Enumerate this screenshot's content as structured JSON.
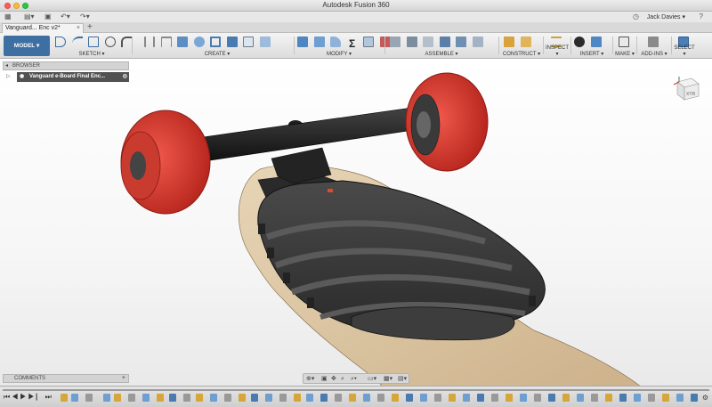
{
  "window": {
    "title": "Autodesk Fusion 360"
  },
  "quick_access": {
    "user_name": "Jack Davies"
  },
  "tabs": [
    {
      "label": "Vanguard... Enc v2*"
    }
  ],
  "ribbon": {
    "workspace": "MODEL",
    "groups": [
      {
        "label": "SKETCH ▾"
      },
      {
        "label": "CREATE ▾"
      },
      {
        "label": "MODIFY ▾"
      },
      {
        "label": "ASSEMBLE ▾"
      },
      {
        "label": "CONSTRUCT ▾"
      },
      {
        "label": "INSPECT ▾"
      },
      {
        "label": "INSERT ▾"
      },
      {
        "label": "MAKE ▾"
      },
      {
        "label": "ADD-INS ▾"
      },
      {
        "label": "SELECT ▾"
      }
    ]
  },
  "browser": {
    "header": "BROWSER",
    "root_item": "Vanguard e-Board Final Enc..."
  },
  "comments": {
    "header": "COMMENTS"
  },
  "viewcube": {
    "label": "XYR"
  },
  "icons": {
    "grid": "app-grid-icon",
    "file": "file-icon",
    "save": "save-icon",
    "undo": "undo-icon",
    "redo": "redo-icon",
    "clock": "job-status-icon",
    "help": "help-icon",
    "eye": "visibility-eye-icon"
  },
  "colors": {
    "wheel": "#e23a2e",
    "truck": "#2b2b2b",
    "deck": "#d8c2a0",
    "enclosure": "#3a3a3a",
    "workspace": "#3e6fa3"
  }
}
